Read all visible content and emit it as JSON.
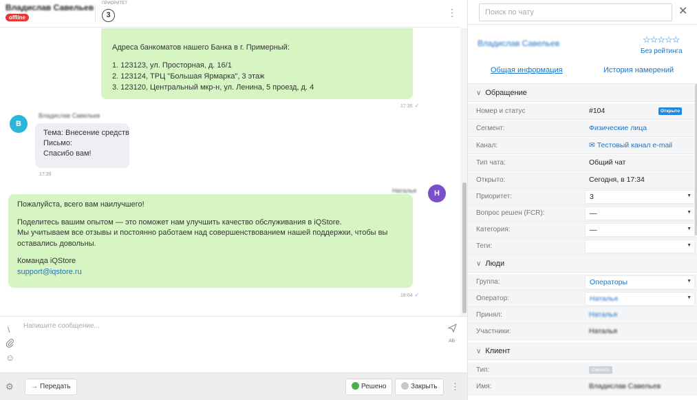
{
  "header": {
    "client_name": "Владислав Савельев",
    "status": "offline",
    "priority_label": "приоритет",
    "priority_value": "3",
    "menu_icon": "more-vertical-icon"
  },
  "messages": {
    "bubble1": {
      "title": "Адреса банкоматов нашего Банка в г. Примерный:",
      "lines": [
        "1. 123123, ул. Просторная, д. 16/1",
        "2. 123124, ТРЦ \"Большая Ярмарка\", 3 этаж",
        "3. 123120, Центральный мкр-н, ул. Ленина, 5 проезд, д. 4"
      ],
      "time": "17:35"
    },
    "bubble2": {
      "avatar_letter": "В",
      "sender": "Владислав Савельев",
      "lines": [
        "Тема: Внесение средств",
        "Письмо:",
        "Спасибо вам!"
      ],
      "time": "17:39"
    },
    "bubble3": {
      "avatar_letter": "Н",
      "sender": "Наталья",
      "lines": [
        "Пожалуйста, всего вам наилучшего!",
        "",
        "Поделитесь вашим опытом — это поможет нам улучшить качество обслуживания в iQStore.",
        "Мы учитываем все отзывы и постоянно работаем над совершенствованием нашей поддержки, чтобы вы",
        "оставались довольны.",
        "",
        "Команда iQStore"
      ],
      "email": "support@iqstore.ru",
      "time": "18:04"
    }
  },
  "composer": {
    "placeholder": "Напишите сообщение...",
    "ab_label": "АБ"
  },
  "footer": {
    "forward_label": "Передать",
    "resolved_label": "Решено",
    "close_label": "Закрыть"
  },
  "right": {
    "search_placeholder": "Поиск по чату",
    "client_name": "Владислав Савельев",
    "rating_stars": "☆☆☆☆☆",
    "rating_label": "Без рейтинга",
    "tab_info": "Общая информация",
    "tab_history": "История намерений",
    "section_appeal": "Обращение",
    "number_status_label": "Номер и статус",
    "number_value": "#104",
    "status_badge": "Открыто",
    "segment_label": "Сегмент:",
    "segment_value": "Физические лица",
    "channel_label": "Канал:",
    "channel_value": "Тестовый канал e-mail",
    "chat_type_label": "Тип чата:",
    "chat_type_value": "Общий чат",
    "opened_label": "Открыто:",
    "opened_value": "Сегодня, в 17:34",
    "priority_label": "Приоритет:",
    "priority_value": "3",
    "fcr_label": "Вопрос решен (FCR):",
    "fcr_value": "—",
    "category_label": "Категория:",
    "category_value": "—",
    "tags_label": "Теги:",
    "tags_value": "",
    "section_people": "Люди",
    "group_label": "Группа:",
    "group_value": "Операторы",
    "operator_label": "Оператор:",
    "operator_value": "Наталья",
    "accepted_label": "Принял:",
    "accepted_value": "Наталья",
    "participants_label": "Участники:",
    "participants_value": "Наталья",
    "section_client": "Клиент",
    "type_label": "Тип:",
    "type_badge": "Сменить",
    "name_label": "Имя:",
    "name_value": "Владислав Савельев"
  }
}
